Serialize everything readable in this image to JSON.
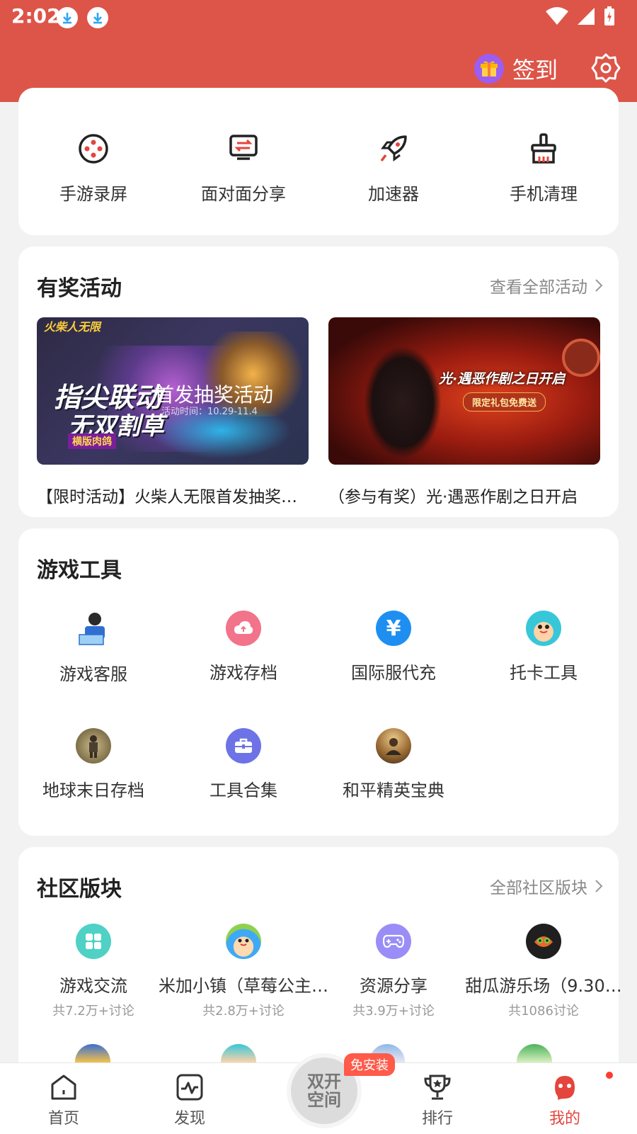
{
  "status_bar": {
    "time": "2:02"
  },
  "header": {
    "checkin_label": "签到"
  },
  "quick_tools": [
    {
      "label": "手游录屏",
      "icon": "screen-record-icon"
    },
    {
      "label": "面对面分享",
      "icon": "face-share-icon"
    },
    {
      "label": "加速器",
      "icon": "rocket-icon"
    },
    {
      "label": "手机清理",
      "icon": "broom-icon"
    }
  ],
  "activities": {
    "title": "有奖活动",
    "view_all": "查看全部活动",
    "items": [
      {
        "caption": "【限时活动】火柴人无限首发抽奖活动",
        "banner_logo": "火柴人无限",
        "banner_title1": "指尖联动",
        "banner_title2": "无双割草",
        "banner_subtitle": "首发抽奖活动",
        "banner_date": "活动时间：10.29-11.4",
        "banner_tag": "横版肉鸽"
      },
      {
        "caption": "（参与有奖）光·遇恶作剧之日开启",
        "banner_title": "光·遇恶作剧之日开启",
        "banner_tag": "限定礼包免费送"
      }
    ]
  },
  "game_tools": {
    "title": "游戏工具",
    "rows": [
      [
        {
          "label": "游戏客服",
          "icon": "customer-service-icon",
          "color": "#2f6fd1"
        },
        {
          "label": "游戏存档",
          "icon": "cloud-upload-icon",
          "color": "#f2738a"
        },
        {
          "label": "国际服代充",
          "icon": "yen-icon",
          "color": "#1e8ff0"
        },
        {
          "label": "托卡工具",
          "icon": "toca-avatar-icon",
          "color": "#37c7d9"
        }
      ],
      [
        {
          "label": "地球末日存档",
          "icon": "survivor-avatar-icon",
          "color": "#6f6a4c"
        },
        {
          "label": "工具合集",
          "icon": "toolbox-icon",
          "color": "#6d73e6"
        },
        {
          "label": "和平精英宝典",
          "icon": "peace-elite-icon",
          "color": "#b58b3c"
        }
      ]
    ]
  },
  "community": {
    "title": "社区版块",
    "view_all": "全部社区版块",
    "items": [
      {
        "label": "游戏交流",
        "sub": "共7.2万+讨论",
        "icon": "grid-icon",
        "color": "#4fd1c5"
      },
      {
        "label": "米加小镇（草莓公主…",
        "sub": "共2.8万+讨论",
        "icon": "miga-avatar-icon",
        "color": "#3fa9f5"
      },
      {
        "label": "资源分享",
        "sub": "共3.9万+讨论",
        "icon": "gamepad-icon",
        "color": "#9a8df7"
      },
      {
        "label": "甜瓜游乐场（9.30…",
        "sub": "共1086讨论",
        "icon": "melon-avatar-icon",
        "color": "#2b2b2b"
      }
    ]
  },
  "bottom_nav": {
    "items": [
      {
        "label": "首页",
        "icon": "home-icon"
      },
      {
        "label": "发现",
        "icon": "discover-icon"
      },
      {
        "label": "排行",
        "icon": "trophy-icon"
      },
      {
        "label": "我的",
        "icon": "profile-icon"
      }
    ],
    "center_label_line1": "双开",
    "center_label_line2": "空间",
    "center_badge": "免安装"
  },
  "colors": {
    "header": "#dd5548",
    "accent": "#e4453c"
  }
}
